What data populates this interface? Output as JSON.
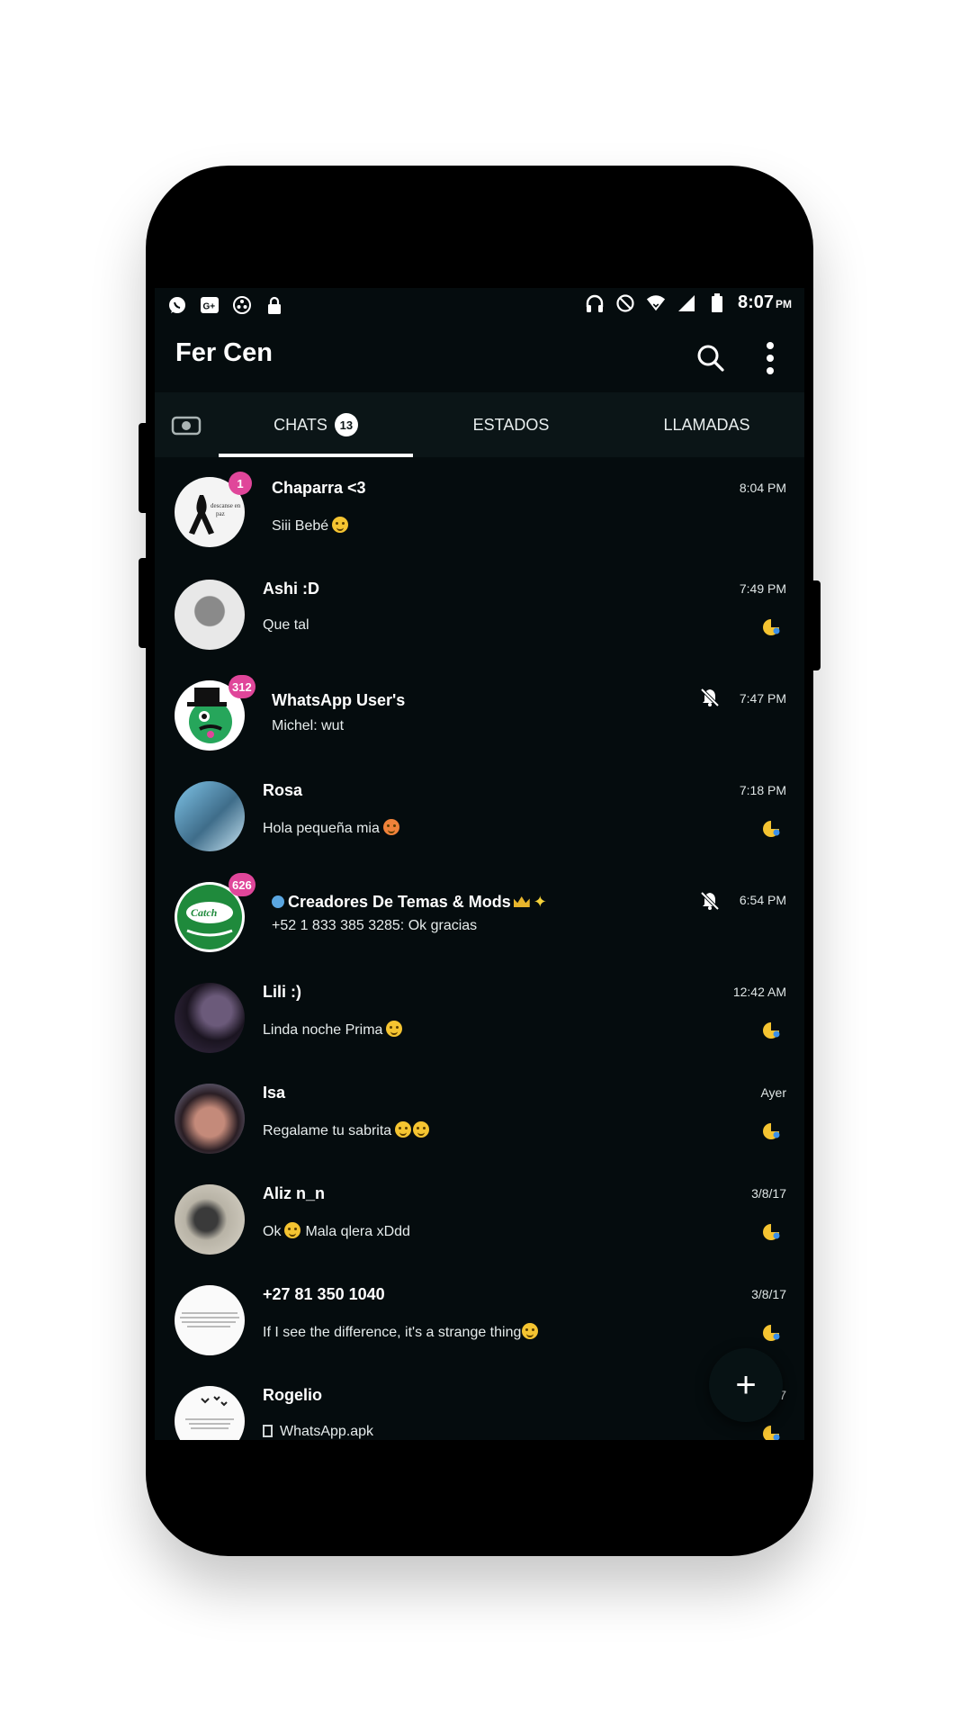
{
  "status_bar": {
    "left_icons": [
      "whatsapp-icon",
      "google-plus-icon",
      "sync-icon",
      "lock-icon"
    ],
    "right_icons": [
      "headphones-icon",
      "do-not-disturb-icon",
      "wifi-icon",
      "cellular-signal-icon",
      "battery-icon"
    ],
    "time": "8:07",
    "ampm": "PM"
  },
  "app_bar": {
    "title": "Fer Cen",
    "search_icon": "search-icon",
    "menu_icon": "more-vert-icon"
  },
  "tabs": {
    "camera_icon": "camera-icon",
    "chats": {
      "label": "CHATS",
      "badge": "13"
    },
    "estados": {
      "label": "ESTADOS"
    },
    "llamadas": {
      "label": "LLAMADAS"
    },
    "active": "chats"
  },
  "chats": [
    {
      "name": "Chaparra <3",
      "message": "Siii Bebé",
      "time": "8:04 PM",
      "badge": "1",
      "muted": false,
      "read_icon": false
    },
    {
      "name": "Ashi :D",
      "message": "Que tal",
      "time": "7:49 PM",
      "badge": "",
      "muted": false,
      "read_icon": true
    },
    {
      "name": "WhatsApp User's",
      "message": "Michel: wut",
      "time": "7:47 PM",
      "badge": "312",
      "muted": true,
      "read_icon": false
    },
    {
      "name": "Rosa",
      "message": "Hola pequeña mia",
      "time": "7:18 PM",
      "badge": "",
      "muted": false,
      "read_icon": true
    },
    {
      "name": "Creadores De Temas & Mods",
      "message": "+52 1 833 385 3285: Ok gracias",
      "time": "6:54 PM",
      "badge": "626",
      "muted": true,
      "read_icon": false
    },
    {
      "name": "Lili :)",
      "message": "Linda noche Prima",
      "time": "12:42 AM",
      "badge": "",
      "muted": false,
      "read_icon": true
    },
    {
      "name": "Isa",
      "message": "Regalame tu sabrita",
      "time": "Ayer",
      "badge": "",
      "muted": false,
      "read_icon": true
    },
    {
      "name": "Aliz n_n",
      "message_a": "Ok",
      "message_b": "Mala qlera xDdd",
      "time": "3/8/17",
      "badge": "",
      "muted": false,
      "read_icon": true
    },
    {
      "name": "+27 81 350 1040",
      "message": "If I see the difference, it's a strange thing",
      "time": "3/8/17",
      "badge": "",
      "muted": false,
      "read_icon": true
    },
    {
      "name": "Rogelio",
      "message": "WhatsApp.apk",
      "time": "7",
      "badge": "",
      "muted": false,
      "read_icon": true
    }
  ],
  "fab": {
    "label": "+"
  },
  "colors": {
    "background": "#050c0e",
    "tab_bar": "#0b1517",
    "badge": "#e0469a",
    "status_emoji": "#f5c431"
  }
}
